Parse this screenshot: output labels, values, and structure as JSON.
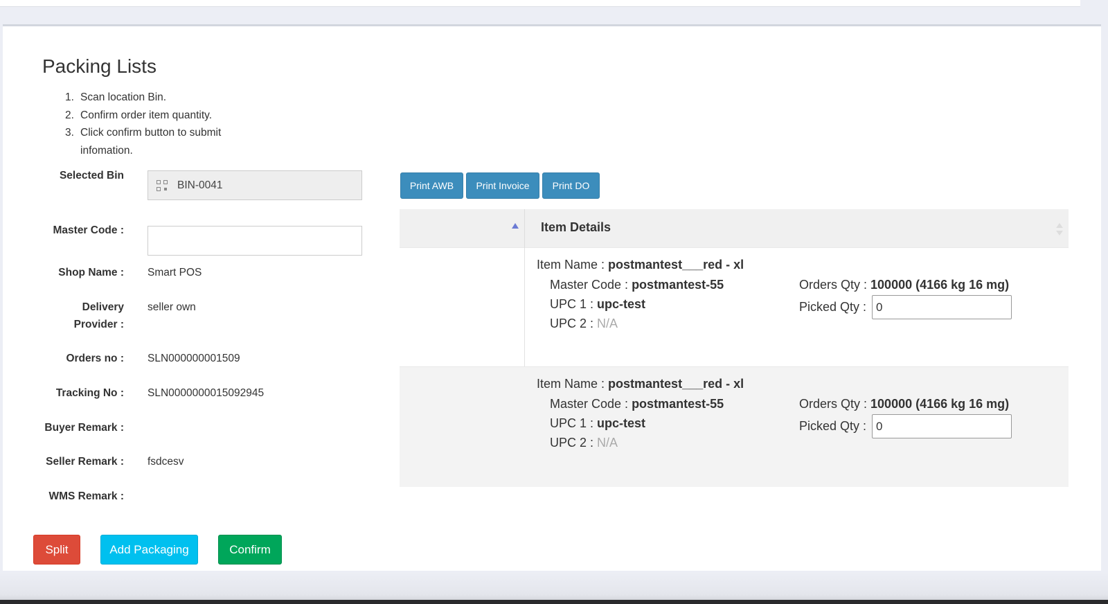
{
  "page": {
    "title": "Packing Lists",
    "instructions": [
      {
        "num": "1.",
        "text": "Scan location Bin."
      },
      {
        "num": "2.",
        "text": "Confirm order item quantity."
      },
      {
        "num": "3.",
        "text": "Click confirm button to submit infomation."
      }
    ]
  },
  "form": {
    "selected_bin_label": "Selected Bin",
    "selected_bin_value": "BIN-0041",
    "master_code_label": "Master Code :",
    "master_code_value": "",
    "shop_name_label": "Shop Name :",
    "shop_name_value": "Smart POS",
    "delivery_provider_label": "Delivery Provider :",
    "delivery_provider_value": "seller own",
    "orders_no_label": "Orders no :",
    "orders_no_value": "SLN000000001509",
    "tracking_no_label": "Tracking No :",
    "tracking_no_value": "SLN0000000015092945",
    "buyer_remark_label": "Buyer Remark :",
    "buyer_remark_value": "",
    "seller_remark_label": "Seller Remark :",
    "seller_remark_value": "fsdcesv",
    "wms_remark_label": "WMS Remark :",
    "wms_remark_value": ""
  },
  "actions": {
    "split": "Split",
    "add_packaging": "Add Packaging",
    "confirm": "Confirm"
  },
  "print_buttons": {
    "awb": "Print AWB",
    "invoice": "Print Invoice",
    "do": "Print DO"
  },
  "table": {
    "header": "Item Details",
    "rows": [
      {
        "item_name_label": "Item Name :",
        "item_name": "postmantest___red - xl",
        "master_code_label": "Master Code :",
        "master_code": "postmantest-55",
        "upc1_label": "UPC 1 :",
        "upc1": "upc-test",
        "upc2_label": "UPC 2 :",
        "upc2": "N/A",
        "orders_qty_label": "Orders Qty :",
        "orders_qty": "100000 (4166 kg 16 mg)",
        "picked_qty_label": "Picked Qty :",
        "picked_qty": "0"
      },
      {
        "item_name_label": "Item Name :",
        "item_name": "postmantest___red - xl",
        "master_code_label": "Master Code :",
        "master_code": "postmantest-55",
        "upc1_label": "UPC 1 :",
        "upc1": "upc-test",
        "upc2_label": "UPC 2 :",
        "upc2": "N/A",
        "orders_qty_label": "Orders Qty :",
        "orders_qty": "100000 (4166 kg 16 mg)",
        "picked_qty_label": "Picked Qty :",
        "picked_qty": "0"
      }
    ]
  },
  "icons": {
    "bin_field": "qrcode-icon"
  },
  "colors": {
    "print_button": "#3c8dbc",
    "split_button": "#dd4b39",
    "add_packaging_button": "#00c0ef",
    "confirm_button": "#00a65a"
  }
}
